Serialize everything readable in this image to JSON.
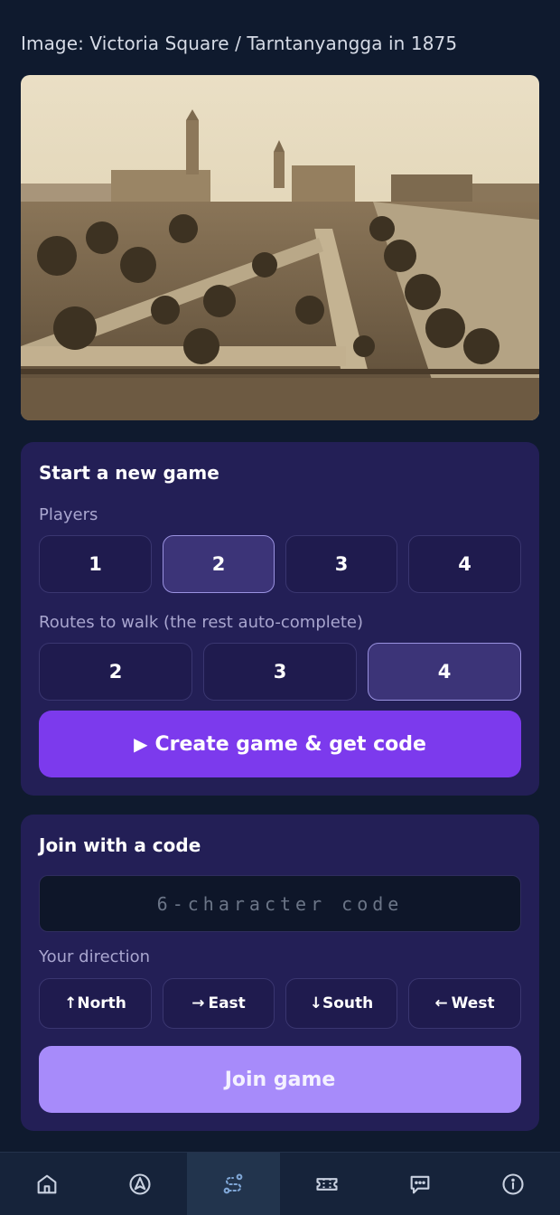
{
  "caption": "Image: Victoria Square / Tarntanyangga in 1875",
  "new_game": {
    "title": "Start a new game",
    "players_label": "Players",
    "players": [
      "1",
      "2",
      "3",
      "4"
    ],
    "players_selected": "2",
    "routes_label": "Routes to walk (the rest auto-complete)",
    "routes": [
      "2",
      "3",
      "4"
    ],
    "routes_selected": "4",
    "create_icon": "play-icon",
    "create_label": "Create game & get code"
  },
  "join": {
    "title": "Join with a code",
    "code_placeholder": "6-character code",
    "code_value": "",
    "direction_label": "Your direction",
    "directions": [
      {
        "arrow": "↑",
        "label": "North"
      },
      {
        "arrow": "→",
        "label": "East"
      },
      {
        "arrow": "↓",
        "label": "South"
      },
      {
        "arrow": "←",
        "label": "West"
      }
    ],
    "join_label": "Join game"
  },
  "nav": {
    "items": [
      "home-icon",
      "navigation-icon",
      "route-icon",
      "ticket-icon",
      "chat-icon",
      "info-icon"
    ],
    "active": "route-icon"
  },
  "colors": {
    "background": "#0f1a2e",
    "card": "#231f56",
    "accent": "#7c3aed",
    "accent_light": "#a78bfa"
  }
}
